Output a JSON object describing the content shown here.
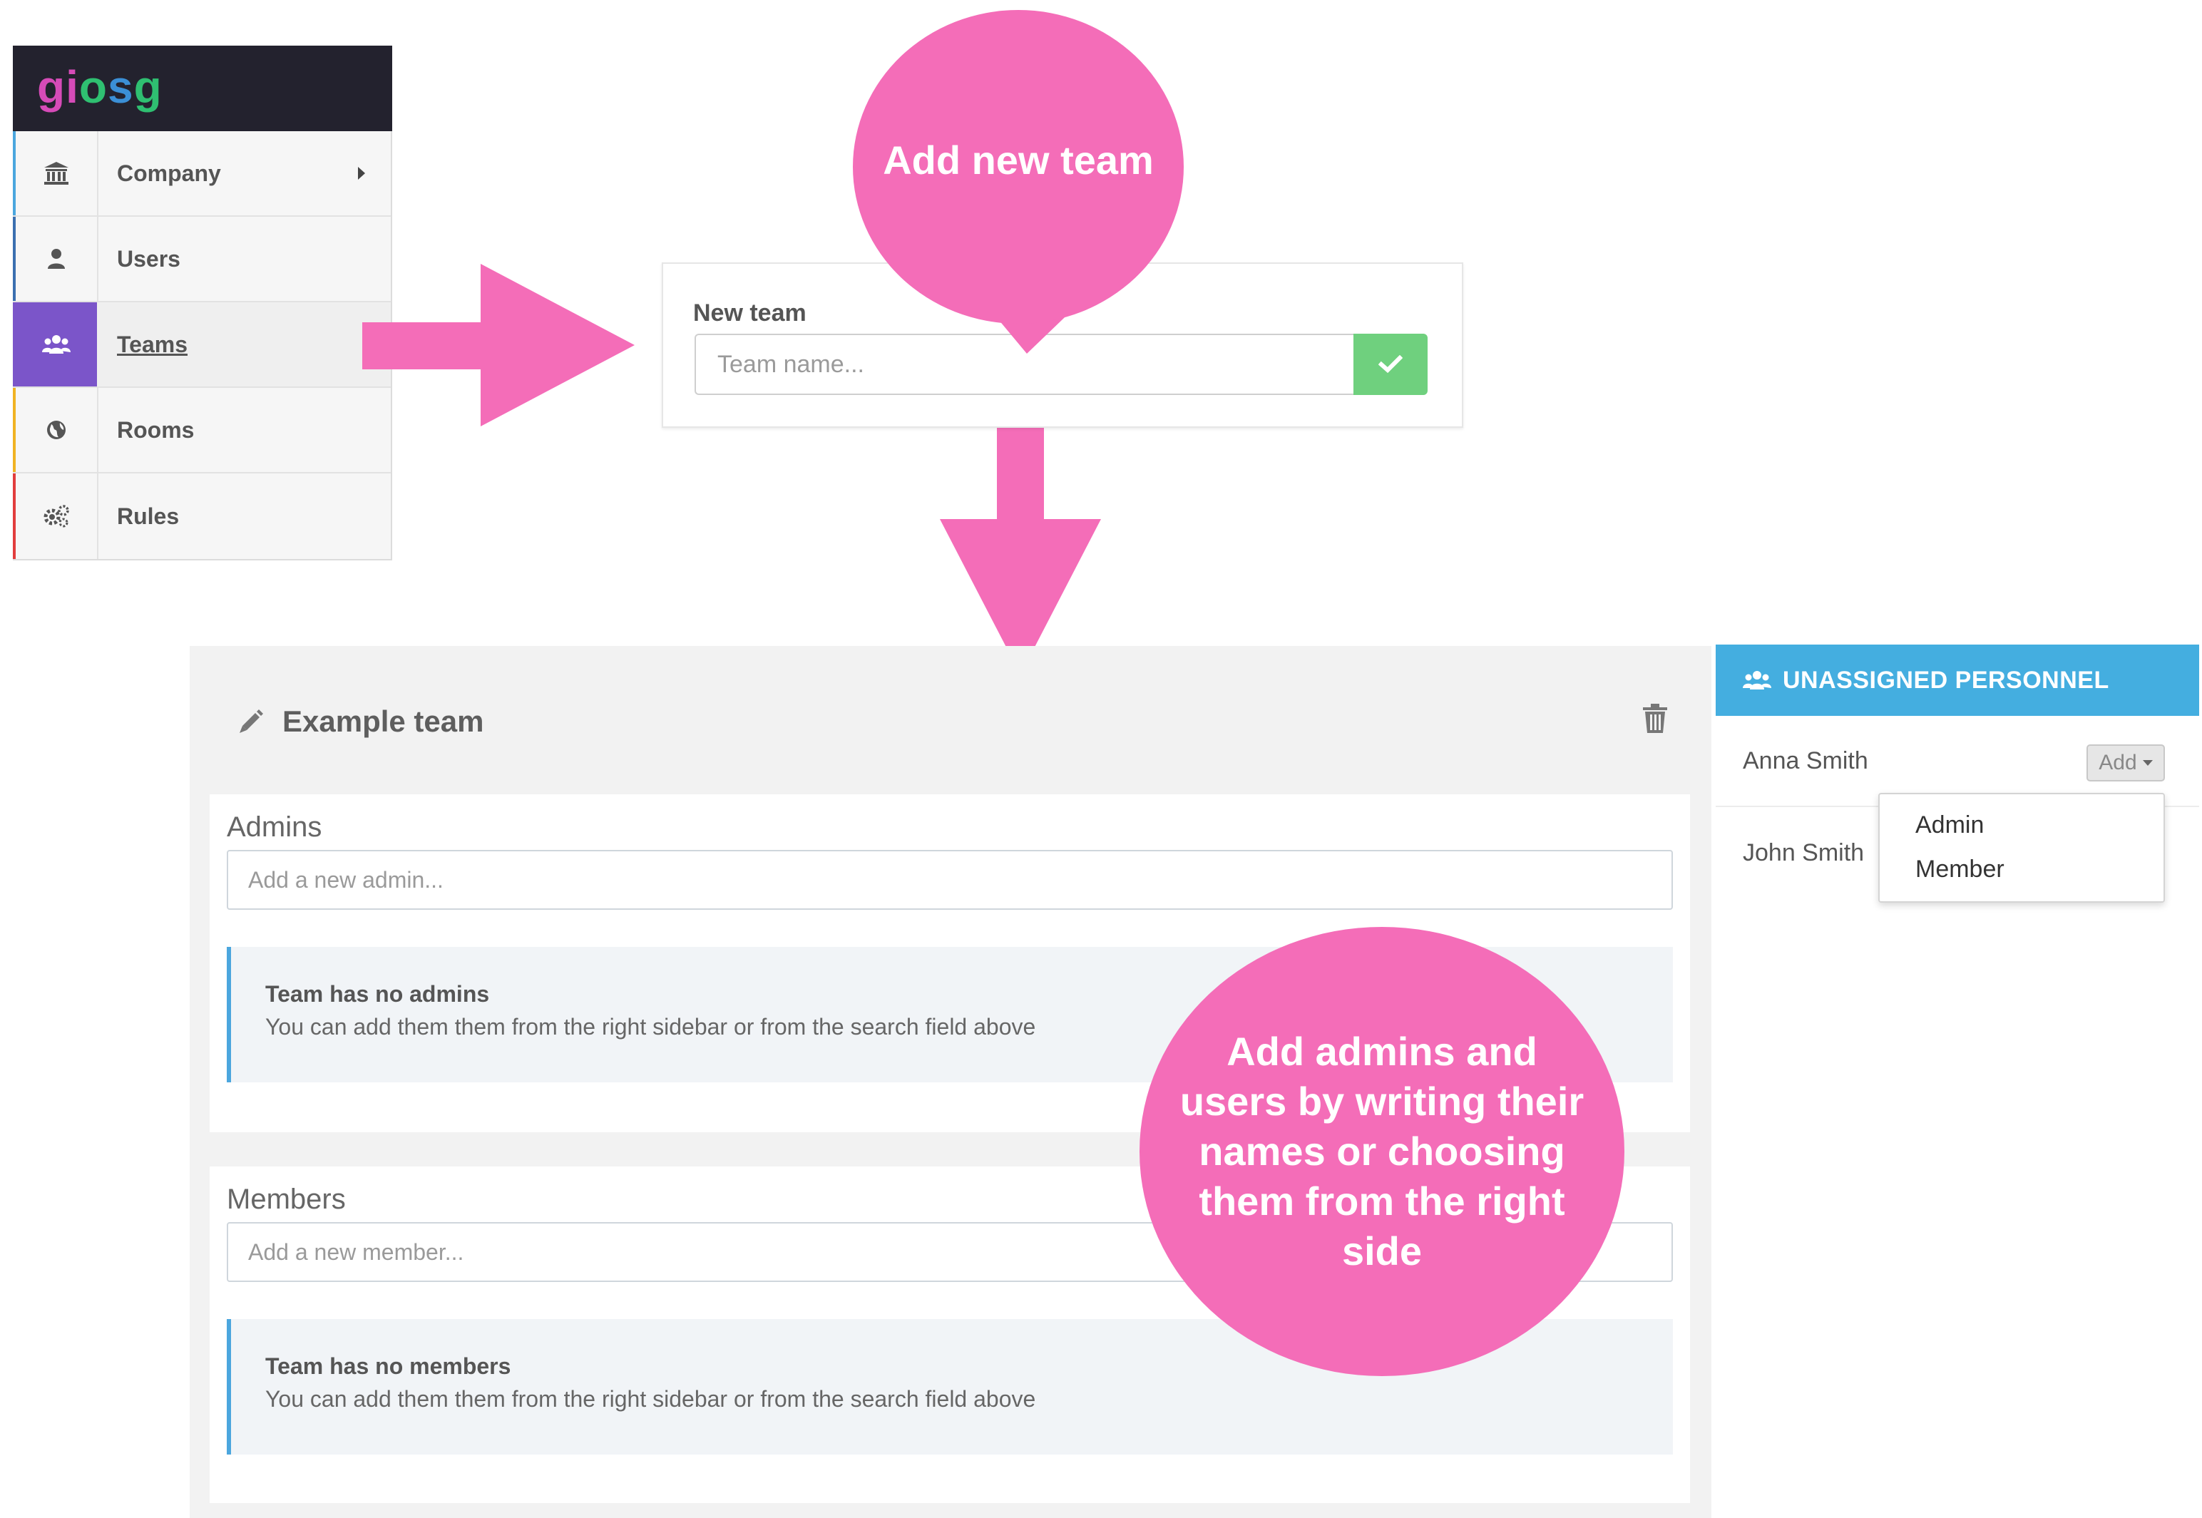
{
  "brand": {
    "logo_text": "giosg"
  },
  "sidebar": {
    "items": [
      {
        "label": "Company",
        "icon": "bank-icon",
        "accent": "#4ba6de",
        "has_submenu": true
      },
      {
        "label": "Users",
        "icon": "user-icon",
        "accent": "#3b6fb0"
      },
      {
        "label": "Teams",
        "icon": "users-group-icon",
        "accent": "#7b55c9",
        "active": true
      },
      {
        "label": "Rooms",
        "icon": "globe-icon",
        "accent": "#f0b323"
      },
      {
        "label": "Rules",
        "icon": "gears-icon",
        "accent": "#e23d3d"
      }
    ]
  },
  "new_team": {
    "title": "New team",
    "input_placeholder": "Team name...",
    "input_value": "",
    "submit_icon": "check-icon"
  },
  "callouts": {
    "add_team": "Add new team",
    "add_people": "Add admins and users by writing their names  or choosing them from the right side"
  },
  "team_editor": {
    "team_name": "Example team",
    "admins": {
      "title": "Admins",
      "input_placeholder": "Add a new admin...",
      "empty_heading": "Team has no admins",
      "empty_text": "You can add them them from the right sidebar or from the search field above"
    },
    "members": {
      "title": "Members",
      "input_placeholder": "Add a new member...",
      "empty_heading": "Team has no members",
      "empty_text": "You can add them them from the right sidebar or from the search field above"
    }
  },
  "personnel": {
    "header": "UNASSIGNED PERSONNEL",
    "people": [
      {
        "name": "Anna Smith",
        "action": "Add"
      },
      {
        "name": "John Smith"
      }
    ],
    "dropdown_options": [
      "Admin",
      "Member"
    ]
  },
  "colors": {
    "pink_accent": "#f46db8",
    "active_nav": "#7b55c9",
    "success": "#6fd07e",
    "header_blue": "#44aee0",
    "info_border": "#4ba6de",
    "brand_bar": "#23222e"
  }
}
